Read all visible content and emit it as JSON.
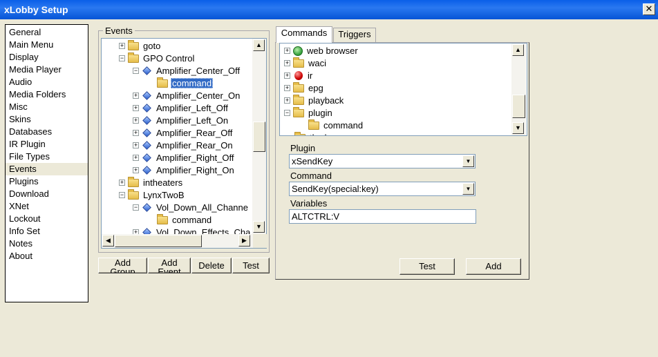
{
  "window": {
    "title": "xLobby Setup",
    "close_glyph": "✕"
  },
  "nav": {
    "items": [
      "General",
      "Main Menu",
      "Display",
      "Media Player",
      "Audio",
      "Media Folders",
      "Misc",
      "Skins",
      "Databases",
      "IR Plugin",
      "File Types",
      "Events",
      "Plugins",
      "Download",
      "XNet",
      "Lockout",
      "Info Set",
      "Notes",
      "About"
    ],
    "selected": "Events"
  },
  "events": {
    "legend": "Events",
    "tree": [
      {
        "label": "goto",
        "icon": "folder-icon",
        "level": 0,
        "expander": "+"
      },
      {
        "label": "GPO Control",
        "icon": "folder-icon",
        "level": 0,
        "expander": "−"
      },
      {
        "label": "Amplifier_Center_Off",
        "icon": "diamond-icon",
        "level": 1,
        "expander": "−"
      },
      {
        "label": "command",
        "icon": "folder-icon",
        "level": 2,
        "selected": true
      },
      {
        "label": "Amplifier_Center_On",
        "icon": "diamond-icon",
        "level": 1,
        "expander": "+"
      },
      {
        "label": "Amplifier_Left_Off",
        "icon": "diamond-icon",
        "level": 1,
        "expander": "+"
      },
      {
        "label": "Amplifier_Left_On",
        "icon": "diamond-icon",
        "level": 1,
        "expander": "+"
      },
      {
        "label": "Amplifier_Rear_Off",
        "icon": "diamond-icon",
        "level": 1,
        "expander": "+"
      },
      {
        "label": "Amplifier_Rear_On",
        "icon": "diamond-icon",
        "level": 1,
        "expander": "+"
      },
      {
        "label": "Amplifier_Right_Off",
        "icon": "diamond-icon",
        "level": 1,
        "expander": "+"
      },
      {
        "label": "Amplifier_Right_On",
        "icon": "diamond-icon",
        "level": 1,
        "expander": "+"
      },
      {
        "label": "intheaters",
        "icon": "folder-icon",
        "level": 0,
        "expander": "+"
      },
      {
        "label": "LynxTwoB",
        "icon": "folder-icon",
        "level": 0,
        "expander": "−"
      },
      {
        "label": "Vol_Down_All_Channe",
        "icon": "diamond-icon",
        "level": 1,
        "expander": "−"
      },
      {
        "label": "command",
        "icon": "folder-icon",
        "level": 2
      },
      {
        "label": "Vol_Down_Effects_Cha",
        "icon": "diamond-icon",
        "level": 1,
        "expander": "+"
      }
    ],
    "buttons": {
      "add_group": "Add\nGroup",
      "add_event": "Add\nEvent",
      "delete": "Delete",
      "test": "Test"
    }
  },
  "tabs": {
    "commands": "Commands",
    "triggers": "Triggers",
    "active": "commands"
  },
  "commands": {
    "tree": [
      {
        "label": "web browser",
        "icon": "globe-icon",
        "level": 0,
        "expander": "+"
      },
      {
        "label": "waci",
        "icon": "folder-icon",
        "level": 0,
        "expander": "+"
      },
      {
        "label": "ir",
        "icon": "red-ball-icon",
        "level": 0,
        "expander": "+"
      },
      {
        "label": "epg",
        "icon": "folder-icon",
        "level": 0,
        "expander": "+"
      },
      {
        "label": "playback",
        "icon": "folder-icon",
        "level": 0,
        "expander": "+"
      },
      {
        "label": "plugin",
        "icon": "folder-icon",
        "level": 0,
        "expander": "−"
      },
      {
        "label": "command",
        "icon": "folder-icon",
        "level": 1
      },
      {
        "label": "th...k",
        "icon": "folder-icon",
        "level": 0
      }
    ],
    "plugin_label": "Plugin",
    "plugin_value": "xSendKey",
    "command_label": "Command",
    "command_value": "SendKey(special:key)",
    "variables_label": "Variables",
    "variables_value": "ALTCTRL:V",
    "test_button": "Test",
    "add_button": "Add"
  },
  "colors": {
    "title_bar": "#0a5fe8",
    "selection": "#316ac5",
    "face": "#ece9d8"
  }
}
